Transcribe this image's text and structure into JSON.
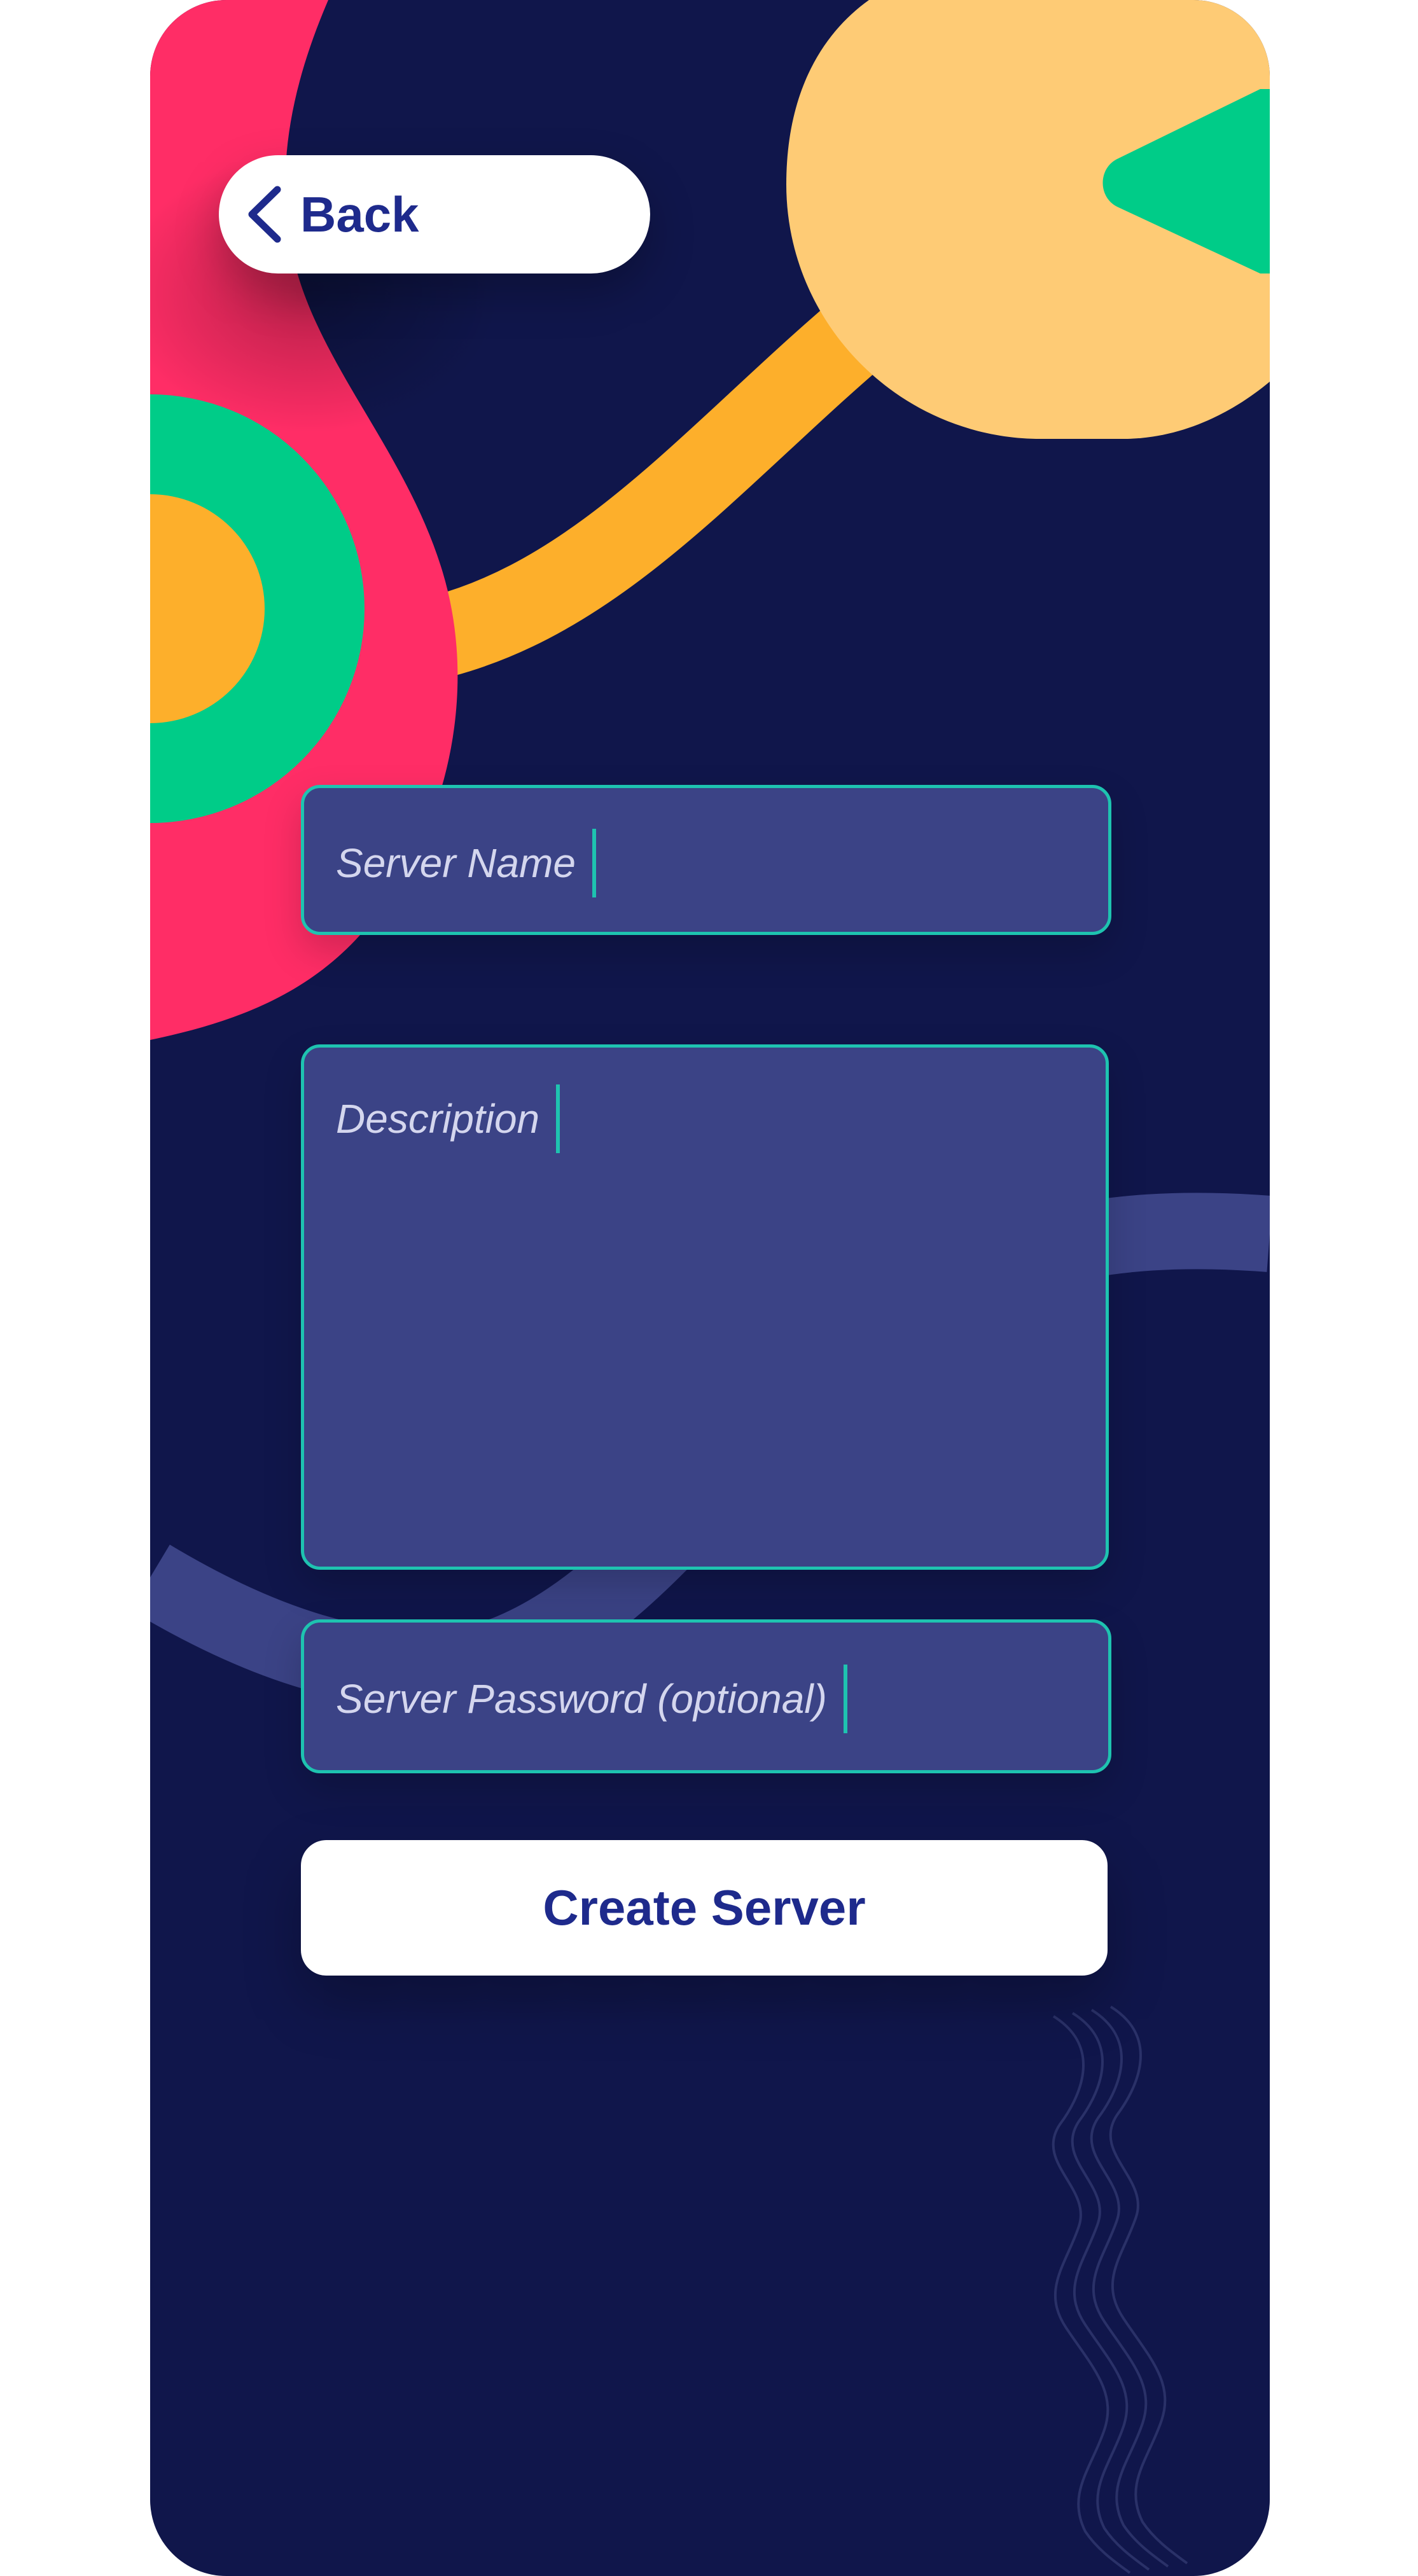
{
  "back_button": {
    "label": "Back",
    "icon": "chevron-left-icon"
  },
  "form": {
    "server_name_placeholder": "Server Name",
    "description_placeholder": "Description",
    "password_placeholder": "Server Password (optional)"
  },
  "create_button": {
    "label": "Create Server"
  },
  "colors": {
    "background": "#10164b",
    "field_fill": "#3b4386",
    "field_border": "#1ec3b0",
    "button_text": "#1e2a8c",
    "accent_pink": "#ff2d66",
    "accent_green": "#00cc88",
    "accent_orange": "#fdaf2b",
    "accent_peach": "#fecb75"
  }
}
